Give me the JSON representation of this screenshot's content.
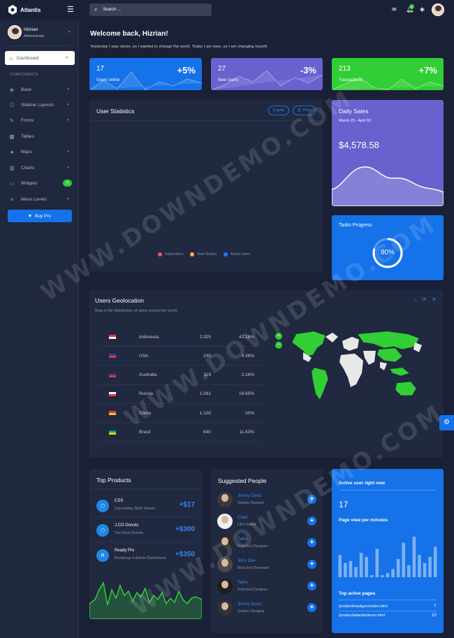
{
  "brand": {
    "name": "Atlantis"
  },
  "search": {
    "placeholder": "Search ..."
  },
  "notifications": {
    "count": "4"
  },
  "user": {
    "name": "Hizrian",
    "role": "Administrator"
  },
  "nav": {
    "dashboard": "Dashboard",
    "section": "COMPONENTS",
    "items": [
      {
        "label": "Base",
        "icon": "layers-icon"
      },
      {
        "label": "Sidebar Layouts",
        "icon": "th-list-icon"
      },
      {
        "label": "Forms",
        "icon": "pen-square-icon"
      },
      {
        "label": "Tables",
        "icon": "table-icon"
      },
      {
        "label": "Maps",
        "icon": "map-marker-icon"
      },
      {
        "label": "Charts",
        "icon": "chart-bar-icon"
      },
      {
        "label": "Widgets",
        "icon": "desktop-icon",
        "badge": "4"
      },
      {
        "label": "Menu Levels",
        "icon": "bars-icon"
      }
    ],
    "buy": "Buy Pro"
  },
  "welcome": {
    "title": "Welcome back, Hizrian!",
    "subtitle": "Yesterday I was clever, so I wanted to change the world. Today I am wise, so I am changing myself."
  },
  "stats": [
    {
      "value": "17",
      "label": "Users online",
      "change": "+5%",
      "color": "#1572e8"
    },
    {
      "value": "27",
      "label": "New Users",
      "change": "-3%",
      "color": "#6861ce"
    },
    {
      "value": "213",
      "label": "Transactions",
      "change": "+7%",
      "color": "#31ce36"
    }
  ],
  "user_stats": {
    "title": "User Statistics",
    "export": "Export",
    "print": "Print",
    "legend": [
      {
        "label": "Subscribers",
        "color": "#f3545d"
      },
      {
        "label": "New Visitors",
        "color": "#fdaf4b"
      },
      {
        "label": "Active Users",
        "color": "#177dff"
      }
    ]
  },
  "daily_sales": {
    "title": "Daily Sales",
    "range": "March 25 - April 02",
    "amount": "$4,578.58"
  },
  "tasks": {
    "title": "Tasks Progress",
    "percent": "80%",
    "value": 0.8
  },
  "geo": {
    "title": "Users Geolocation",
    "subtitle": "Map of the distribution of users around the world",
    "rows": [
      {
        "country": "Indonesia",
        "users": "2.320",
        "pct": "42.18%"
      },
      {
        "country": "USA",
        "users": "240",
        "pct": "4.36%"
      },
      {
        "country": "Australia",
        "users": "119",
        "pct": "2.16%"
      },
      {
        "country": "Russia",
        "users": "1.081",
        "pct": "19.65%"
      },
      {
        "country": "China",
        "users": "1.100",
        "pct": "20%"
      },
      {
        "country": "Brasil",
        "users": "640",
        "pct": "11.63%"
      }
    ]
  },
  "products": {
    "title": "Top Products",
    "items": [
      {
        "name": "CSS",
        "desc": "Cascading Style Sheets",
        "price": "+$17",
        "icon": "css3-icon"
      },
      {
        "name": "J.CO Donuts",
        "desc": "The Best Donuts",
        "price": "+$300",
        "icon": "css3-icon"
      },
      {
        "name": "Ready Pro",
        "desc": "Bootstrap 4 Admin Dashboard",
        "price": "+$350",
        "icon": "R"
      }
    ]
  },
  "people": {
    "title": "Suggested People",
    "items": [
      {
        "name": "Jimmy Denis",
        "role": "Graphic Designer"
      },
      {
        "name": "Chad",
        "role": "CEO Zeleaf"
      },
      {
        "name": "Talha",
        "role": "Front End Designer"
      },
      {
        "name": "John Doe",
        "role": "Back End Developer"
      },
      {
        "name": "Talha",
        "role": "Front End Designer"
      },
      {
        "name": "Jimmy Denis",
        "role": "Graphic Designer"
      }
    ]
  },
  "active": {
    "title": "Active user right now",
    "value": "17",
    "pv_title": "Page view per minutes",
    "bars": [
      0.55,
      0.35,
      0.4,
      0.25,
      0.6,
      0.5,
      0.05,
      0.7,
      0.05,
      0.1,
      0.2,
      0.45,
      0.85,
      0.3,
      1,
      0.55,
      0.35,
      0.5,
      0.75
    ],
    "pages_title": "Top active pages",
    "pages": [
      {
        "url": "/product/readypro/index.html",
        "count": "7"
      },
      {
        "url": "/product/atlantis/demo.html",
        "count": "10"
      }
    ]
  },
  "watermark": "WWW.DOWNDEMO.COM"
}
